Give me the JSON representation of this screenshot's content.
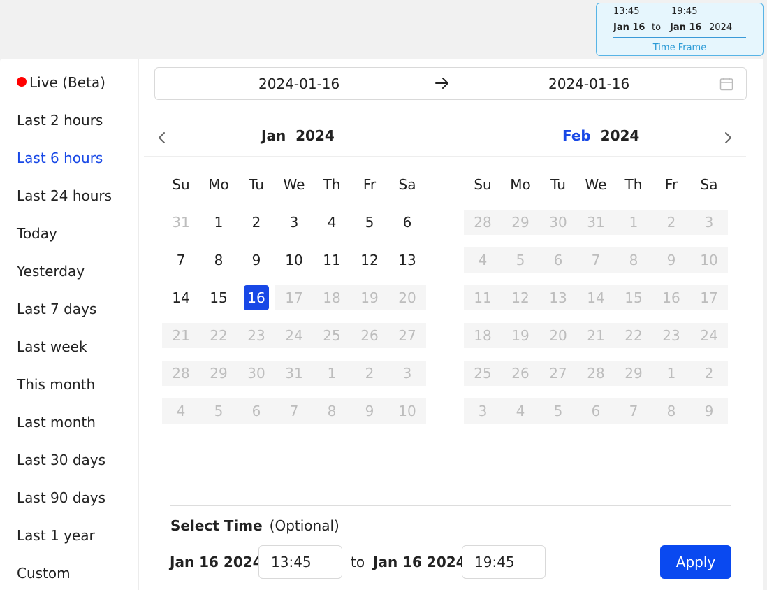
{
  "timeframe_chip": {
    "start_time": "13:45",
    "end_time": "19:45",
    "start_date": "Jan 16",
    "to": "to",
    "end_date": "Jan 16",
    "year": "2024",
    "label": "Time Frame"
  },
  "sidebar": {
    "items": [
      {
        "label": "Live (Beta)",
        "active": false,
        "live": true
      },
      {
        "label": "Last 2 hours",
        "active": false
      },
      {
        "label": "Last 6 hours",
        "active": true
      },
      {
        "label": "Last 24 hours",
        "active": false
      },
      {
        "label": "Today",
        "active": false
      },
      {
        "label": "Yesterday",
        "active": false
      },
      {
        "label": "Last 7 days",
        "active": false
      },
      {
        "label": "Last week",
        "active": false
      },
      {
        "label": "This month",
        "active": false
      },
      {
        "label": "Last month",
        "active": false
      },
      {
        "label": "Last 30 days",
        "active": false
      },
      {
        "label": "Last 90 days",
        "active": false
      },
      {
        "label": "Last 1 year",
        "active": false
      },
      {
        "label": "Custom",
        "active": false
      }
    ]
  },
  "range": {
    "start": "2024-01-16",
    "end": "2024-01-16"
  },
  "calendars": {
    "weekdays": [
      "Su",
      "Mo",
      "Tu",
      "We",
      "Th",
      "Fr",
      "Sa"
    ],
    "left": {
      "month": "Jan",
      "year": "2024",
      "weeks": [
        [
          {
            "d": "31",
            "s": "muted"
          },
          {
            "d": "1"
          },
          {
            "d": "2"
          },
          {
            "d": "3"
          },
          {
            "d": "4"
          },
          {
            "d": "5"
          },
          {
            "d": "6"
          }
        ],
        [
          {
            "d": "7"
          },
          {
            "d": "8"
          },
          {
            "d": "9"
          },
          {
            "d": "10"
          },
          {
            "d": "11"
          },
          {
            "d": "12"
          },
          {
            "d": "13"
          }
        ],
        [
          {
            "d": "14"
          },
          {
            "d": "15"
          },
          {
            "d": "16",
            "s": "sel"
          },
          {
            "d": "17",
            "s": "dis"
          },
          {
            "d": "18",
            "s": "dis"
          },
          {
            "d": "19",
            "s": "dis"
          },
          {
            "d": "20",
            "s": "dis"
          }
        ],
        [
          {
            "d": "21",
            "s": "dis"
          },
          {
            "d": "22",
            "s": "dis"
          },
          {
            "d": "23",
            "s": "dis"
          },
          {
            "d": "24",
            "s": "dis"
          },
          {
            "d": "25",
            "s": "dis"
          },
          {
            "d": "26",
            "s": "dis"
          },
          {
            "d": "27",
            "s": "dis"
          }
        ],
        [
          {
            "d": "28",
            "s": "dis"
          },
          {
            "d": "29",
            "s": "dis"
          },
          {
            "d": "30",
            "s": "dis"
          },
          {
            "d": "31",
            "s": "dis"
          },
          {
            "d": "1",
            "s": "dis"
          },
          {
            "d": "2",
            "s": "dis"
          },
          {
            "d": "3",
            "s": "dis"
          }
        ],
        [
          {
            "d": "4",
            "s": "dis"
          },
          {
            "d": "5",
            "s": "dis"
          },
          {
            "d": "6",
            "s": "dis"
          },
          {
            "d": "7",
            "s": "dis"
          },
          {
            "d": "8",
            "s": "dis"
          },
          {
            "d": "9",
            "s": "dis"
          },
          {
            "d": "10",
            "s": "dis"
          }
        ]
      ]
    },
    "right": {
      "month": "Feb",
      "year": "2024",
      "weeks": [
        [
          {
            "d": "28",
            "s": "dis"
          },
          {
            "d": "29",
            "s": "dis"
          },
          {
            "d": "30",
            "s": "dis"
          },
          {
            "d": "31",
            "s": "dis"
          },
          {
            "d": "1",
            "s": "dis"
          },
          {
            "d": "2",
            "s": "dis"
          },
          {
            "d": "3",
            "s": "dis"
          }
        ],
        [
          {
            "d": "4",
            "s": "dis"
          },
          {
            "d": "5",
            "s": "dis"
          },
          {
            "d": "6",
            "s": "dis"
          },
          {
            "d": "7",
            "s": "dis"
          },
          {
            "d": "8",
            "s": "dis"
          },
          {
            "d": "9",
            "s": "dis"
          },
          {
            "d": "10",
            "s": "dis"
          }
        ],
        [
          {
            "d": "11",
            "s": "dis"
          },
          {
            "d": "12",
            "s": "dis"
          },
          {
            "d": "13",
            "s": "dis"
          },
          {
            "d": "14",
            "s": "dis"
          },
          {
            "d": "15",
            "s": "dis"
          },
          {
            "d": "16",
            "s": "dis"
          },
          {
            "d": "17",
            "s": "dis"
          }
        ],
        [
          {
            "d": "18",
            "s": "dis"
          },
          {
            "d": "19",
            "s": "dis"
          },
          {
            "d": "20",
            "s": "dis"
          },
          {
            "d": "21",
            "s": "dis"
          },
          {
            "d": "22",
            "s": "dis"
          },
          {
            "d": "23",
            "s": "dis"
          },
          {
            "d": "24",
            "s": "dis"
          }
        ],
        [
          {
            "d": "25",
            "s": "dis"
          },
          {
            "d": "26",
            "s": "dis"
          },
          {
            "d": "27",
            "s": "dis"
          },
          {
            "d": "28",
            "s": "dis"
          },
          {
            "d": "29",
            "s": "dis"
          },
          {
            "d": "1",
            "s": "dis"
          },
          {
            "d": "2",
            "s": "dis"
          }
        ],
        [
          {
            "d": "3",
            "s": "dis"
          },
          {
            "d": "4",
            "s": "dis"
          },
          {
            "d": "5",
            "s": "dis"
          },
          {
            "d": "6",
            "s": "dis"
          },
          {
            "d": "7",
            "s": "dis"
          },
          {
            "d": "8",
            "s": "dis"
          },
          {
            "d": "9",
            "s": "dis"
          }
        ]
      ]
    }
  },
  "time_select": {
    "title": "Select Time",
    "optional": "(Optional)",
    "start_date": "Jan 16 2024",
    "start_time": "13:45",
    "to": "to",
    "end_date": "Jan 16 2024",
    "end_time": "19:45",
    "apply_label": "Apply"
  },
  "colors": {
    "accent": "#1848e6",
    "apply": "#0a49f0",
    "live_dot": "#ff0000",
    "chip_bg": "#e6f6fd",
    "chip_border": "#58b4e6"
  },
  "icons": {
    "range_arrow": "arrow-right-icon",
    "calendar": "calendar-icon",
    "prev": "chevron-left-icon",
    "next": "chevron-right-icon"
  }
}
